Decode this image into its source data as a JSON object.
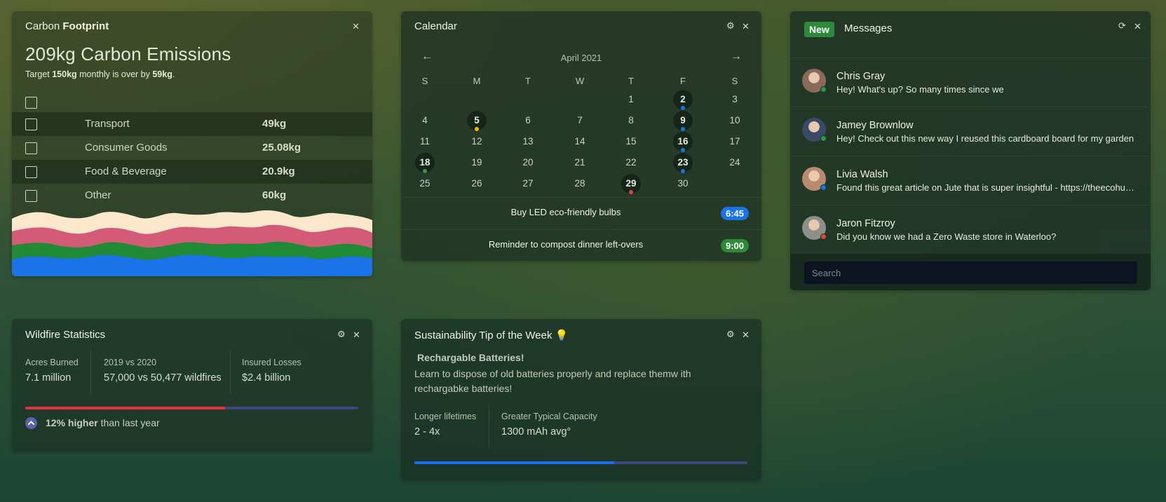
{
  "carbon": {
    "title_prefix": "Carbon",
    "title_bold": "Footprint",
    "headline": "209kg Carbon Emissions",
    "target_pre": "Target ",
    "target_value": "150kg",
    "target_mid": " monthly is over by ",
    "target_over": "59kg",
    "target_end": ".",
    "rows": [
      {
        "label": "Transport",
        "value": "49kg"
      },
      {
        "label": "Consumer Goods",
        "value": "25.08kg"
      },
      {
        "label": "Food & Beverage",
        "value": "20.9kg"
      },
      {
        "label": "Other",
        "value": "60kg"
      }
    ],
    "wave_colors": [
      "#fbe8cc",
      "#d45b78",
      "#218a36",
      "#1a73e8"
    ]
  },
  "calendar": {
    "title": "Calendar",
    "month": "April 2021",
    "prev": "←",
    "next": "→",
    "weekdays": [
      "S",
      "M",
      "T",
      "W",
      "T",
      "F",
      "S"
    ],
    "weeks": [
      [
        "",
        "",
        "",
        "",
        "1",
        "2",
        "3"
      ],
      [
        "4",
        "5",
        "6",
        "7",
        "8",
        "9",
        "10"
      ],
      [
        "11",
        "12",
        "13",
        "14",
        "15",
        "16",
        "17"
      ],
      [
        "18",
        "19",
        "20",
        "21",
        "22",
        "23",
        "24"
      ],
      [
        "25",
        "26",
        "27",
        "28",
        "29",
        "30",
        ""
      ]
    ],
    "marked": {
      "2": "#1a73e8",
      "5": "#f4b400",
      "9": "#1a73e8",
      "16": "#1a73e8",
      "18": "#2c9a44",
      "23": "#1a73e8",
      "29": "#e0443a"
    },
    "events": [
      {
        "text": "Buy LED eco-friendly bulbs",
        "time": "6:45",
        "color": "#1a73e8"
      },
      {
        "text": "Reminder to compost dinner left-overs",
        "time": "9:00",
        "color": "#2c8a3a"
      }
    ]
  },
  "messages": {
    "badge": "New",
    "title": "Messages",
    "items": [
      {
        "name": "Chris Gray",
        "text": "Hey! What's up? So many times since we",
        "status": "#2c9a44",
        "avatar": "#8a6a5a"
      },
      {
        "name": "Jamey Brownlow",
        "text": "Hey! Check out this new way I reused this cardboard board for my garden",
        "status": "#2c9a44",
        "avatar": "#3a4a66"
      },
      {
        "name": "Livia Walsh",
        "text": "Found this great article on Jute that is super insightful - https://theecohub.com/jute",
        "status": "#1a73e8",
        "avatar": "#b88a70"
      },
      {
        "name": "Jaron Fitzroy",
        "text": "Did you know we had a Zero Waste store in Waterloo?",
        "status": "#e0443a",
        "avatar": "#8c8f8a"
      }
    ],
    "search_placeholder": "Search"
  },
  "wildfire": {
    "title": "Wildfire Statistics",
    "stats": [
      {
        "label": "Acres Burned",
        "value": "7.1 million"
      },
      {
        "label": "2019 vs 2020",
        "value": "57,000 vs 50,477 wildfires"
      },
      {
        "label": "Insured Losses",
        "value": "$2.4 billion"
      }
    ],
    "progress": 0.6,
    "progress_color": "#e0353e",
    "change_bold": "12% higher",
    "change_rest": " than last year"
  },
  "tip": {
    "title": "Sustainability Tip of the Week 💡",
    "heading": "Rechargable Batteries!",
    "body": " Learn to dispose of old batteries properly and replace themw ith rechargabke batteries!",
    "stats": [
      {
        "label": "Longer lifetimes",
        "value": "2 - 4x"
      },
      {
        "label": "Greater Typical Capacity",
        "value": "1300 mAh avg°"
      }
    ],
    "progress": 0.6,
    "progress_color": "#1a6ef0"
  }
}
